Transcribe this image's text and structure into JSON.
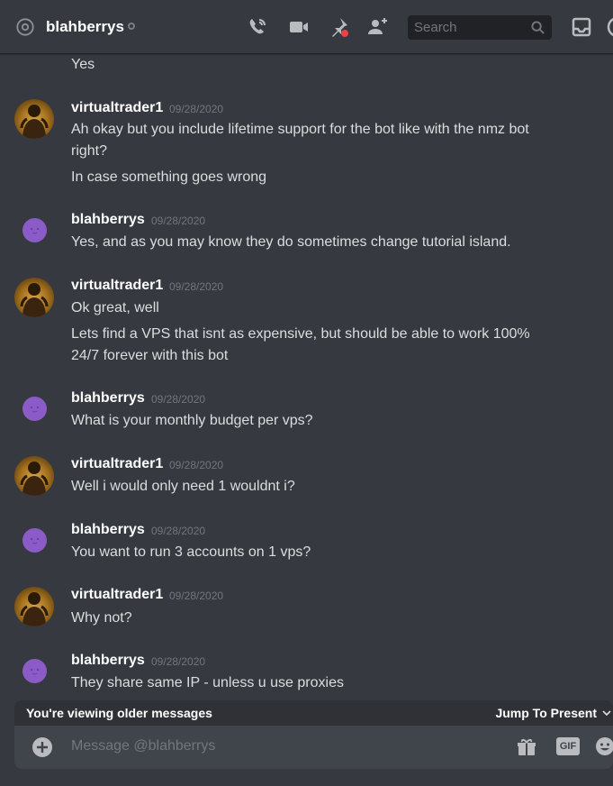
{
  "header": {
    "channel_name": "blahberrys",
    "search_placeholder": "Search",
    "icons": [
      "at-icon",
      "call-icon",
      "video-icon",
      "pin-icon",
      "add-friend-icon",
      "search-icon",
      "inbox-icon",
      "help-icon"
    ]
  },
  "messages": [
    {
      "author": "",
      "timestamp": "",
      "lines": [
        "Yes"
      ]
    },
    {
      "author": "virtualtrader1",
      "timestamp": "09/28/2020",
      "lines": [
        "Ah okay but you include lifetime support for the bot like with the nmz bot",
        "right?",
        "In case something goes wrong"
      ]
    },
    {
      "author": "blahberrys",
      "timestamp": "09/28/2020",
      "lines": [
        "Yes, and as you may know they do sometimes change tutorial island."
      ]
    },
    {
      "author": "virtualtrader1",
      "timestamp": "09/28/2020",
      "lines": [
        "Ok great, well",
        "Lets find a VPS that isnt as expensive, but should be able to work 100%",
        "24/7 forever with this bot"
      ]
    },
    {
      "author": "blahberrys",
      "timestamp": "09/28/2020",
      "lines": [
        "What is your monthly budget per vps?"
      ]
    },
    {
      "author": "virtualtrader1",
      "timestamp": "09/28/2020",
      "lines": [
        "Well i would only need 1 wouldnt i?"
      ]
    },
    {
      "author": "blahberrys",
      "timestamp": "09/28/2020",
      "lines": [
        "You want to run 3 accounts on 1 vps?"
      ]
    },
    {
      "author": "virtualtrader1",
      "timestamp": "09/28/2020",
      "lines": [
        "Why not?"
      ]
    },
    {
      "author": "blahberrys",
      "timestamp": "09/28/2020",
      "lines": [
        "They share same IP - unless u use proxies"
      ]
    }
  ],
  "older_bar": {
    "label": "You're viewing older messages",
    "jump": "Jump To Present"
  },
  "composer": {
    "placeholder": "Message @blahberrys",
    "gif_label": "GIF"
  },
  "colors": {
    "background": "#36393f",
    "username": "#ffffff",
    "timestamp": "#72767d",
    "text": "#dcddde",
    "blahberrys_avatar": "#8b5cc7"
  }
}
